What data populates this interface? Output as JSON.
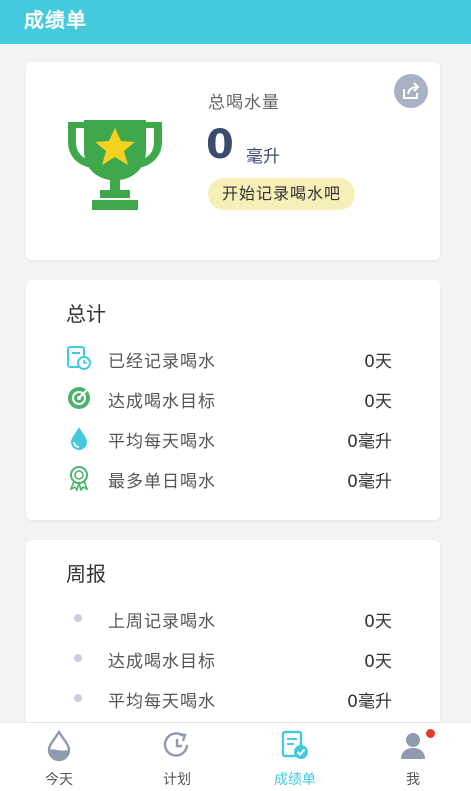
{
  "header": {
    "title": "成绩单"
  },
  "total": {
    "label": "总喝水量",
    "value": "0",
    "unit": "毫升",
    "start_button": "开始记录喝水吧"
  },
  "summary": {
    "title": "总计",
    "rows": [
      {
        "icon": "calendar-clock-icon",
        "label": "已经记录喝水",
        "value": "0天"
      },
      {
        "icon": "target-icon",
        "label": "达成喝水目标",
        "value": "0天"
      },
      {
        "icon": "water-drop-icon",
        "label": "平均每天喝水",
        "value": "0毫升"
      },
      {
        "icon": "medal-icon",
        "label": "最多单日喝水",
        "value": "0毫升"
      }
    ]
  },
  "weekly": {
    "title": "周报",
    "rows": [
      {
        "label": "上周记录喝水",
        "value": "0天"
      },
      {
        "label": "达成喝水目标",
        "value": "0天"
      },
      {
        "label": "平均每天喝水",
        "value": "0毫升"
      }
    ]
  },
  "tabs": [
    {
      "icon": "water-drop-icon",
      "label": "今天",
      "active": false
    },
    {
      "icon": "clock-refresh-icon",
      "label": "计划",
      "active": false
    },
    {
      "icon": "report-check-icon",
      "label": "成绩单",
      "active": true
    },
    {
      "icon": "user-icon",
      "label": "我",
      "active": false,
      "badge": true
    }
  ],
  "colors": {
    "header": "#45c9dd",
    "accent": "#45c9dd",
    "trophy": "#3fa84b",
    "star": "#f5d21f",
    "button_bg": "#f6efb8",
    "badge": "#e23b2e"
  }
}
